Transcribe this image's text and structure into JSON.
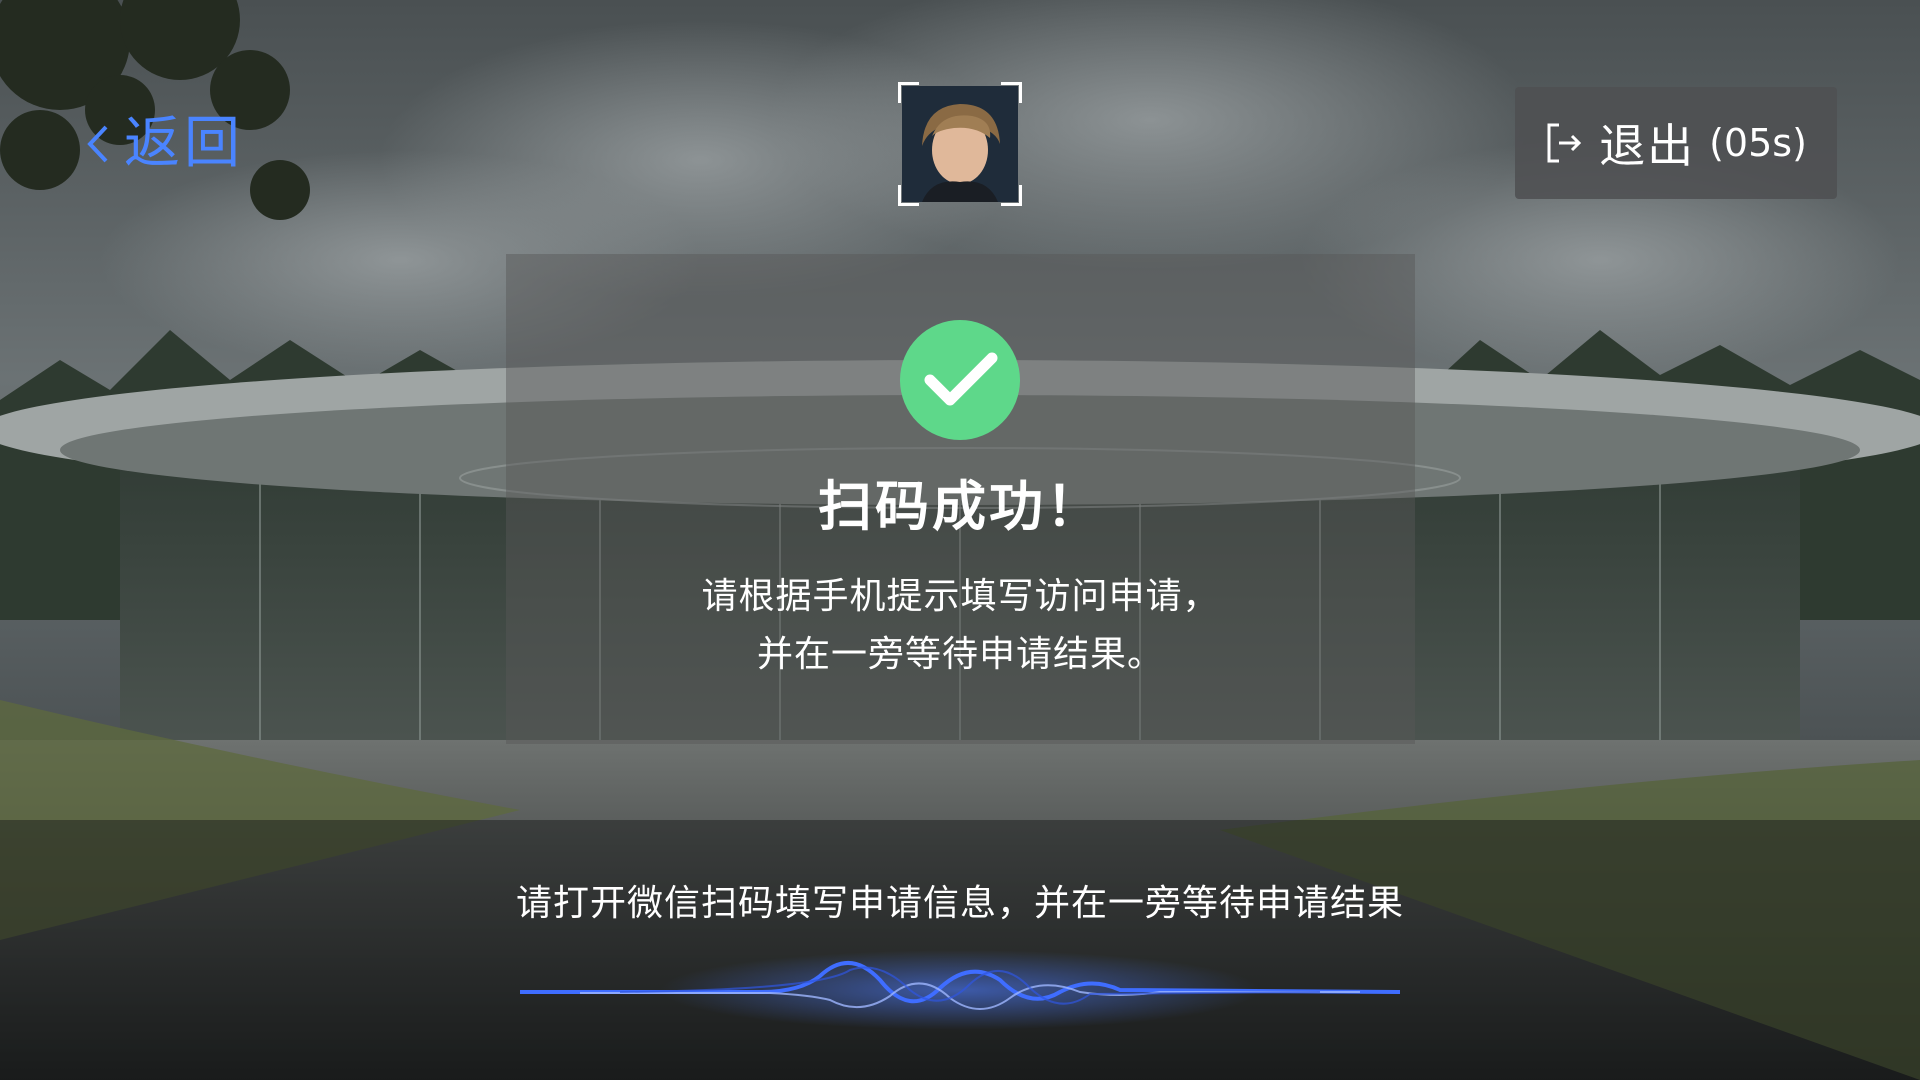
{
  "colors": {
    "accent": "#4a84ff",
    "success": "#5ed88a",
    "text": "#ffffff",
    "exit_bg": "#4e5052"
  },
  "header": {
    "back_label": "返回",
    "back_icon": "chevron-left-icon",
    "avatar_icon": "face-scan-frame",
    "exit_icon": "logout-icon",
    "exit_label": "退出",
    "exit_countdown": "(05s)"
  },
  "result": {
    "status_icon": "check-circle-icon",
    "title": "扫码成功！",
    "message_lines": [
      "请根据手机提示填写访问申请，",
      "并在一旁等待申请结果。"
    ]
  },
  "footer": {
    "tip": "请打开微信扫码填写申请信息，并在一旁等待申请结果",
    "voice_icon": "voice-wave-icon"
  }
}
